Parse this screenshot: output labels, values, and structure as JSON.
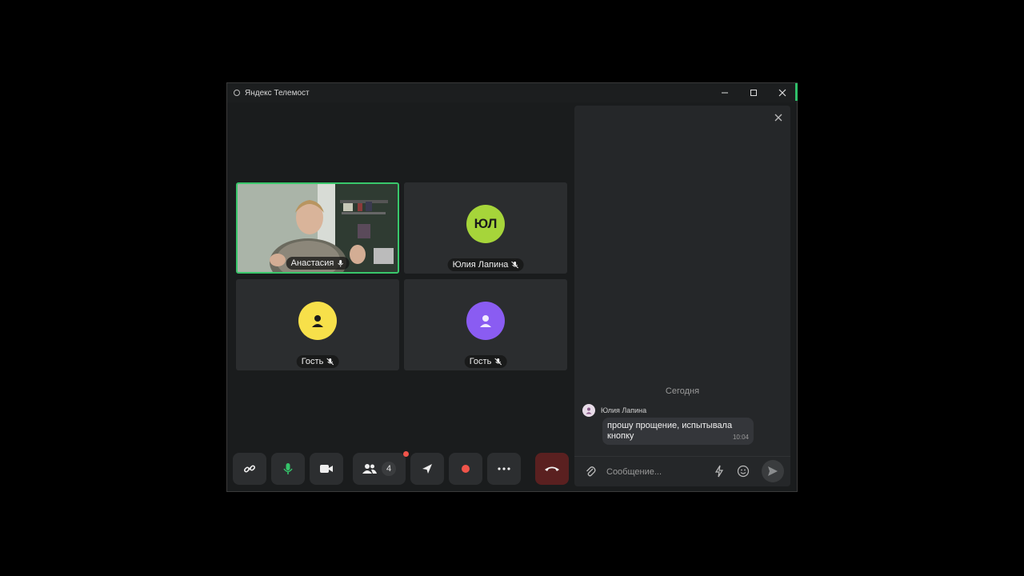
{
  "app": {
    "title": "Яндекс Телемост"
  },
  "participants": [
    {
      "name": "Анастасия",
      "type": "video",
      "active": true
    },
    {
      "name": "Юлия Лапина",
      "type": "initials",
      "initials": "ЮЛ",
      "color": "#a6d53a"
    },
    {
      "name": "Гость",
      "type": "icon",
      "color": "#f7e04a"
    },
    {
      "name": "Гость",
      "type": "icon",
      "color": "#8a5cf2"
    }
  ],
  "toolbar": {
    "participants_count": "4"
  },
  "chat": {
    "date_label": "Сегодня",
    "messages": [
      {
        "author": "Юлия Лапина",
        "text": "прошу прощение, испытывала кнопку",
        "time": "10:04"
      }
    ],
    "input_placeholder": "Сообщение..."
  },
  "colors": {
    "active_border": "#39c76b",
    "mic_active": "#35c46a",
    "end_call": "#5a2020",
    "record": "#f0544a"
  }
}
